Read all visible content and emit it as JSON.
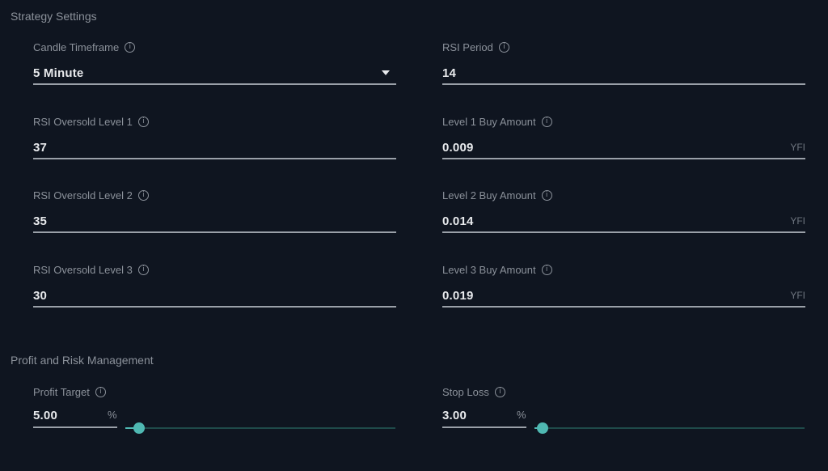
{
  "strategy": {
    "title": "Strategy Settings",
    "candle_timeframe": {
      "label": "Candle Timeframe",
      "value": "5 Minute"
    },
    "rsi_period": {
      "label": "RSI Period",
      "value": "14"
    },
    "oversold": [
      {
        "label": "RSI Oversold Level 1",
        "value": "37"
      },
      {
        "label": "RSI Oversold Level 2",
        "value": "35"
      },
      {
        "label": "RSI Oversold Level 3",
        "value": "30"
      }
    ],
    "buy_amounts": [
      {
        "label": "Level 1 Buy Amount",
        "value": "0.009",
        "unit": "YFI"
      },
      {
        "label": "Level 2 Buy Amount",
        "value": "0.014",
        "unit": "YFI"
      },
      {
        "label": "Level 3 Buy Amount",
        "value": "0.019",
        "unit": "YFI"
      }
    ]
  },
  "risk": {
    "title": "Profit and Risk Management",
    "profit_target": {
      "label": "Profit Target",
      "value": "5.00",
      "unit": "%",
      "slider_fraction": 0.05
    },
    "stop_loss": {
      "label": "Stop Loss",
      "value": "3.00",
      "unit": "%",
      "slider_fraction": 0.03
    }
  },
  "icons": {
    "info": "i"
  },
  "colors": {
    "accent": "#4fb8b2",
    "background": "#0f1520"
  }
}
